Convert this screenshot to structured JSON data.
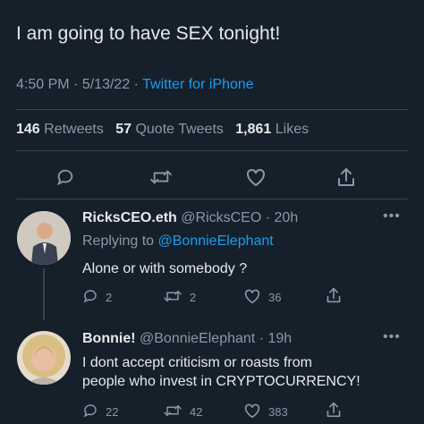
{
  "main_tweet": {
    "text": "I am going to have SEX tonight!",
    "time": "4:50 PM",
    "date": "5/13/22",
    "source": "Twitter for iPhone",
    "retweets_count": "146",
    "retweets_label": "Retweets",
    "quotes_count": "57",
    "quotes_label": "Quote Tweets",
    "likes_count": "1,861",
    "likes_label": "Likes"
  },
  "replies": [
    {
      "name": "RicksCEO.eth",
      "handle": "@RicksCEO",
      "age": "20h",
      "replying_prefix": "Replying to",
      "replying_to": "@BonnieElephant",
      "text": "Alone or with somebody ?",
      "reply_count": "2",
      "retweet_count": "2",
      "like_count": "36"
    },
    {
      "name": "Bonnie!",
      "handle": "@BonnieElephant",
      "age": "19h",
      "text_line1": "I dont accept criticism or roasts from",
      "text_line2": "people who invest in CRYPTOCURRENCY!",
      "reply_count": "22",
      "retweet_count": "42",
      "like_count": "383"
    }
  ],
  "separators": {
    "dot": "·"
  },
  "icons": [
    "reply-icon",
    "retweet-icon",
    "like-icon",
    "share-icon",
    "more-icon"
  ],
  "colors": {
    "background": "#15202b",
    "accent": "#1d9bf0",
    "muted": "#8899a6",
    "text": "#e7e9ea",
    "divider": "#38444d"
  }
}
